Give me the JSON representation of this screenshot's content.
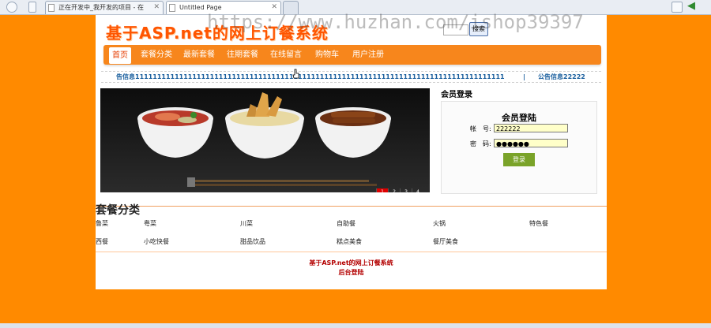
{
  "browser": {
    "tabs": [
      {
        "label": "正在开发中_我开发的项目 - 在"
      },
      {
        "label": "Untitled Page"
      }
    ]
  },
  "site": {
    "title": "基于ASP.net的网上订餐系统",
    "search_button": "搜索"
  },
  "nav": {
    "items": [
      {
        "label": "首页"
      },
      {
        "label": "套餐分类"
      },
      {
        "label": "最新套餐"
      },
      {
        "label": "往期套餐"
      },
      {
        "label": "在线留言"
      },
      {
        "label": "购物车"
      },
      {
        "label": "用户注册"
      }
    ]
  },
  "notice": {
    "item1": "告信息111111111111111111111111111111111111111111111111111111111111111111111111111111111111",
    "separator": "|",
    "item2": "公告信息22222"
  },
  "slideshow": {
    "pages": [
      "1",
      "2",
      "3",
      "4",
      "5"
    ],
    "active_page": "1"
  },
  "login": {
    "section_title": "会员登录",
    "box_title": "会员登陆",
    "username_label": "帐　号:",
    "username_value": "222222",
    "password_label": "密　码:",
    "password_value": "●●●●●●",
    "submit_label": "登录"
  },
  "categories": {
    "title": "套餐分类",
    "items": [
      {
        "label": "鲁菜"
      },
      {
        "label": "粤菜"
      },
      {
        "label": "川菜"
      },
      {
        "label": "自助餐"
      },
      {
        "label": "火锅"
      },
      {
        "label": "特色餐"
      },
      {
        "label": "西餐"
      },
      {
        "label": "小吃快餐"
      },
      {
        "label": "甜品饮品"
      },
      {
        "label": "糕点美食"
      },
      {
        "label": "餐厅美食"
      }
    ]
  },
  "footer": {
    "line1": "基于ASP.net的网上订餐系统",
    "line2": "后台登陆"
  },
  "watermark": "https://www.huzhan.com/ishop39397",
  "colors": {
    "background": "#ff8a00",
    "nav": "#f7861c",
    "title": "#ff5500",
    "login_button": "#7aa329",
    "footer_text": "#b30000"
  }
}
